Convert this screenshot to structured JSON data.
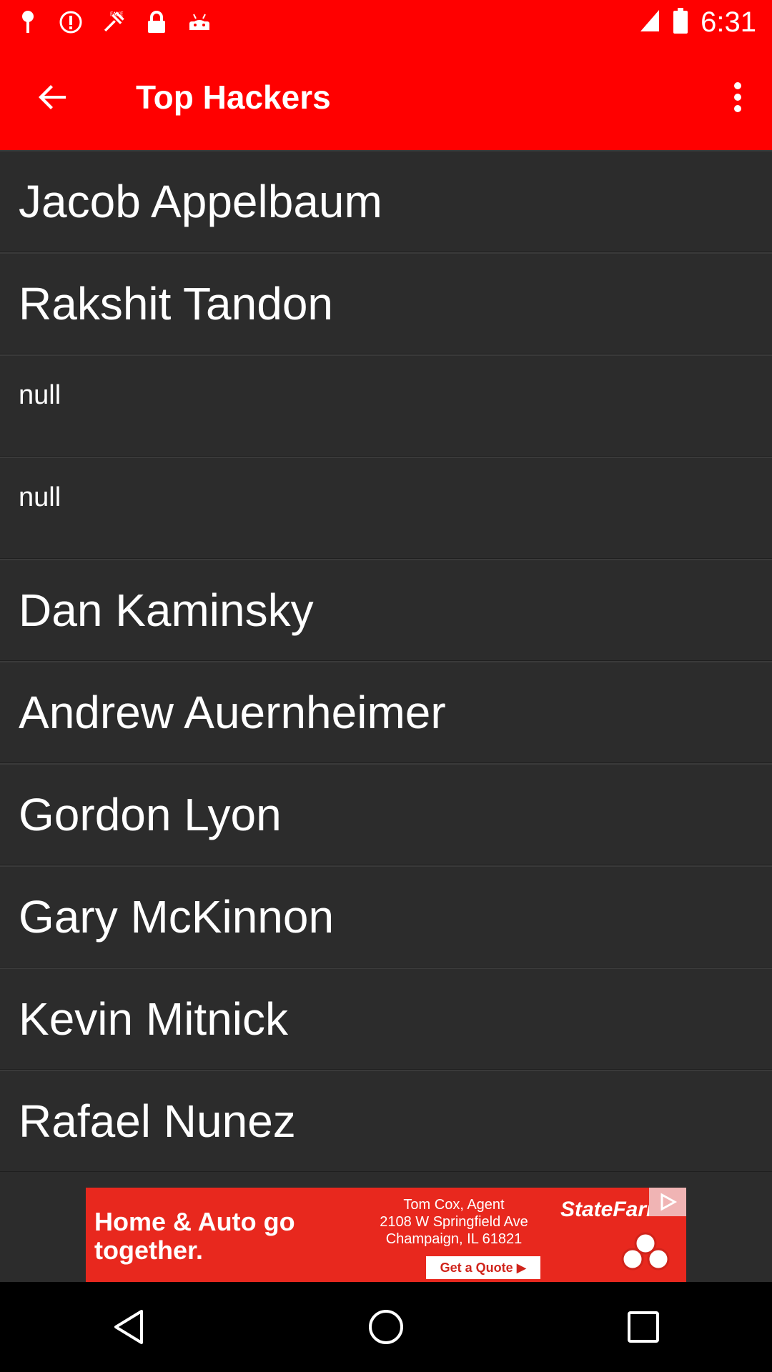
{
  "status_bar": {
    "time": "6:31",
    "icons": [
      "location-pin-icon",
      "alert-icon",
      "fake-gps-icon",
      "lock-icon",
      "android-icon",
      "signal-icon",
      "battery-icon"
    ]
  },
  "app_bar": {
    "title": "Top Hackers",
    "back_icon": "arrow-back-icon",
    "overflow_icon": "more-vert-icon"
  },
  "list": {
    "items": [
      "Jacob Appelbaum",
      "Rakshit Tandon",
      "null",
      "null",
      "Dan Kaminsky",
      "Andrew Auernheimer",
      "Gordon Lyon",
      "Gary McKinnon",
      "Kevin Mitnick",
      "Rafael Nunez"
    ]
  },
  "ad": {
    "headline": "Home & Auto go together.",
    "agent_line1": "Tom Cox, Agent",
    "agent_line2": "2108 W Springfield Ave",
    "agent_line3": "Champaign, IL 61821",
    "cta": "Get a Quote ▶",
    "brand": "StateFarm"
  },
  "colors": {
    "app_bar": "#ff0000",
    "list_bg": "#2c2c2c",
    "nav_bar": "#000000"
  }
}
